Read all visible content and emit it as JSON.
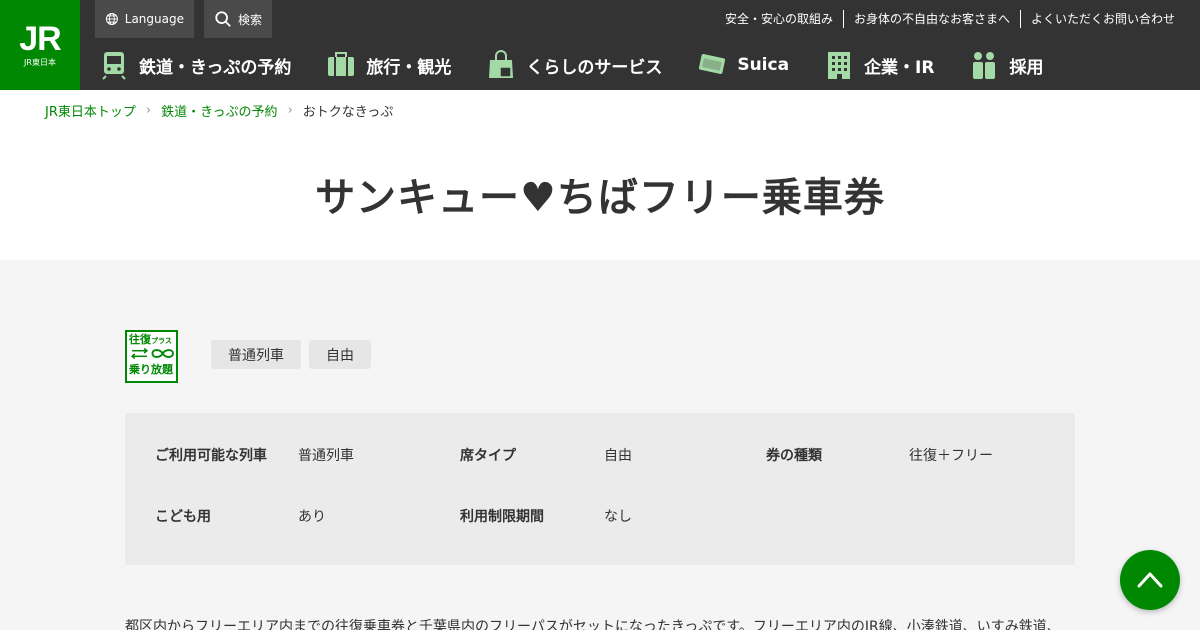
{
  "header": {
    "logo": {
      "main": "JR",
      "sub": "JR東日本"
    },
    "language_label": "Language",
    "search_label": "検索",
    "top_links": [
      "安全・安心の取組み",
      "お身体の不自由なお客さまへ",
      "よくいただくお問い合わせ"
    ],
    "nav": [
      {
        "label": "鉄道・きっぷの予約",
        "icon": "train-icon"
      },
      {
        "label": "旅行・観光",
        "icon": "suitcase-icon"
      },
      {
        "label": "くらしのサービス",
        "icon": "shopping-bag-icon"
      },
      {
        "label": "Suica",
        "icon": "card-icon"
      },
      {
        "label": "企業・IR",
        "icon": "building-icon"
      },
      {
        "label": "採用",
        "icon": "people-icon"
      }
    ]
  },
  "breadcrumb": {
    "items": [
      "JR東日本トップ",
      "鉄道・きっぷの予約"
    ],
    "current": "おトクなきっぷ"
  },
  "page_title": "サンキュー♥ちばフリー乗車券",
  "badge": {
    "line1": "往復",
    "line1_small": "プラス",
    "line3": "乗り放題"
  },
  "tags": [
    "普通列車",
    "自由"
  ],
  "info": {
    "row1": [
      {
        "label": "ご利用可能な列車",
        "value": "普通列車"
      },
      {
        "label": "席タイプ",
        "value": "自由"
      },
      {
        "label": "券の種類",
        "value": "往復＋フリー"
      }
    ],
    "row2": [
      {
        "label": "こども用",
        "value": "あり"
      },
      {
        "label": "利用制限期間",
        "value": "なし"
      }
    ]
  },
  "description": "都区内からフリーエリア内までの往復乗車券と千葉県内のフリーパスがセットになったきっぷです。フリーエリア内のJR線、小湊鉄道、いすみ鉄道、",
  "colors": {
    "brand_green": "#008803",
    "header_bg": "#333333"
  }
}
